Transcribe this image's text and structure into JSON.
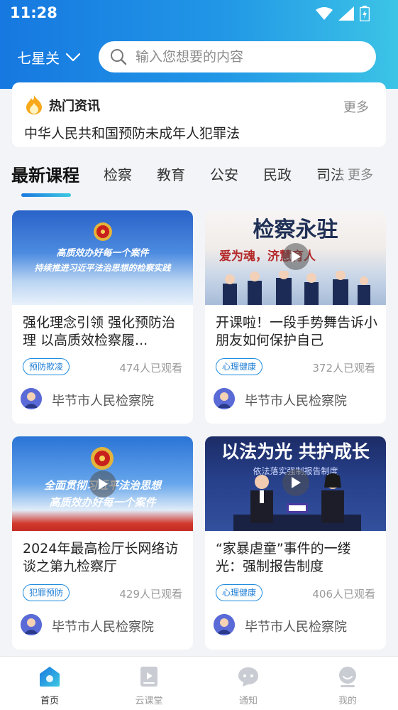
{
  "status": {
    "time": "11:28"
  },
  "header": {
    "location": "七星关",
    "search_placeholder": "输入您想要的内容"
  },
  "news": {
    "title": "热门资讯",
    "more": "更多",
    "headline": "中华人民共和国预防未成年人犯罪法"
  },
  "tabs": {
    "items": [
      "最新课程",
      "检察",
      "教育",
      "公安",
      "民政",
      "司法"
    ],
    "more": "更多"
  },
  "courses": [
    {
      "title": "强化理念引领 强化预防治理 以高质效检察履...",
      "tag": "预防欺凌",
      "views": "474人已观看",
      "org": "毕节市人民检察院",
      "thumb_text_1": "高质效办好每一个案件",
      "thumb_text_2": "持续推进习近平法治思想的检察实践"
    },
    {
      "title": "开课啦！一段手势舞告诉小朋友如何保护自己",
      "tag": "心理健康",
      "views": "372人已观看",
      "org": "毕节市人民检察院",
      "thumb_text_1": "检察永驻",
      "thumb_text_2": "爱为魂，济慧育人"
    },
    {
      "title": "2024年最高检厅长网络访谈之第九检察厅",
      "tag": "犯罪预防",
      "views": "429人已观看",
      "org": "毕节市人民检察院",
      "thumb_text_1": "全面贯彻习近平法治思想",
      "thumb_text_2": "高质效办好每一个案件"
    },
    {
      "title": "“家暴虐童”事件的一缕光：强制报告制度",
      "tag": "心理健康",
      "views": "406人已观看",
      "org": "毕节市人民检察院",
      "thumb_text_1": "以法为光 共护成长",
      "thumb_text_2": "依法落实强制报告制度"
    }
  ],
  "bottom_nav": [
    {
      "label": "首页",
      "icon": "home-icon",
      "active": true
    },
    {
      "label": "云课堂",
      "icon": "video-class-icon",
      "active": false
    },
    {
      "label": "通知",
      "icon": "message-icon",
      "active": false
    },
    {
      "label": "我的",
      "icon": "profile-icon",
      "active": false
    }
  ],
  "colors": {
    "accent": "#1f8bdd",
    "header_start": "#1678e0",
    "header_end": "#3cc4e6"
  }
}
